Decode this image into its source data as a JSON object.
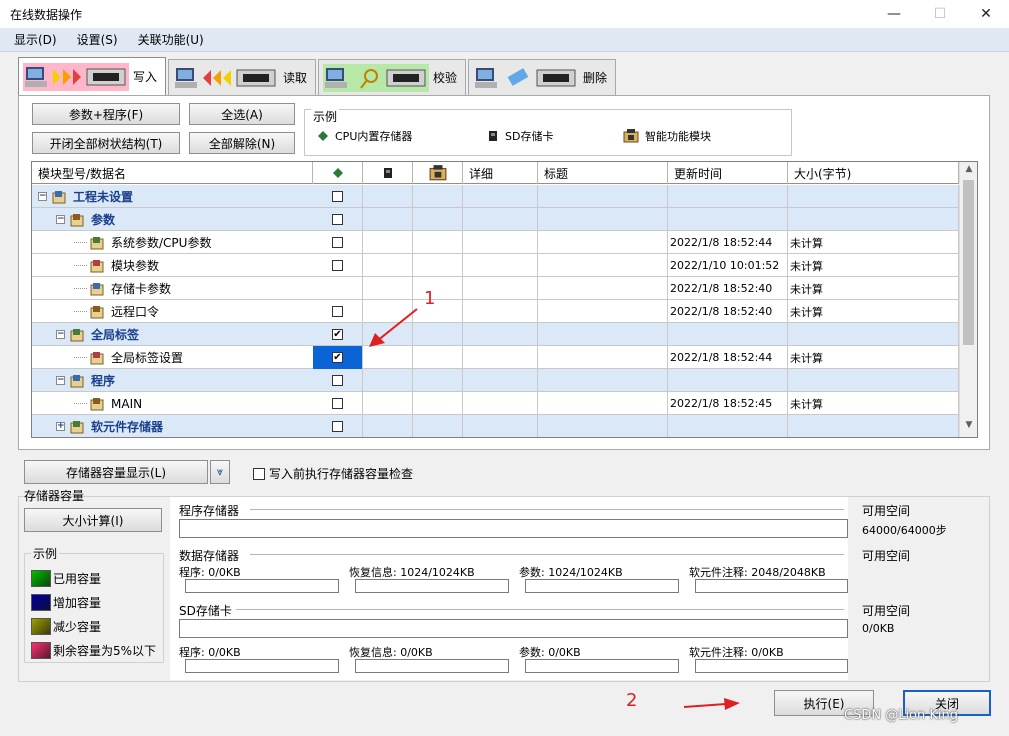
{
  "window": {
    "title": "在线数据操作",
    "minimize": "—",
    "maximize": "☐",
    "close": "✕"
  },
  "menu": [
    "显示(D)",
    "设置(S)",
    "关联功能(U)"
  ],
  "tabs": [
    {
      "label": "写入",
      "active": true
    },
    {
      "label": "读取",
      "active": false
    },
    {
      "label": "校验",
      "active": false
    },
    {
      "label": "删除",
      "active": false
    }
  ],
  "buttons": {
    "param_program": "参数+程序(F)",
    "select_all": "全选(A)",
    "toggle_tree": "开闭全部树状结构(T)",
    "deselect_all": "全部解除(N)",
    "mem_capacity": "存储器容量显示(L)",
    "size_calc": "大小计算(I)",
    "execute": "执行(E)",
    "close": "关闭"
  },
  "legend_top": {
    "title": "示例",
    "items": [
      "CPU内置存储器",
      "SD存储卡",
      "智能功能模块"
    ]
  },
  "grid": {
    "headers": [
      "模块型号/数据名",
      "",
      "",
      "",
      "详细",
      "标题",
      "更新时间",
      "大小(字节)"
    ],
    "rows": [
      {
        "name": "工程未设置",
        "level": 0,
        "group": true,
        "expander": "−",
        "cpu": "unchecked",
        "time": "",
        "size": ""
      },
      {
        "name": "参数",
        "level": 1,
        "group": true,
        "expander": "−",
        "cpu": "unchecked",
        "time": "",
        "size": ""
      },
      {
        "name": "系统参数/CPU参数",
        "level": 2,
        "group": false,
        "expander": "",
        "cpu": "unchecked",
        "time": "2022/1/8 18:52:44",
        "size": "未计算"
      },
      {
        "name": "模块参数",
        "level": 2,
        "group": false,
        "expander": "",
        "cpu": "unchecked",
        "time": "2022/1/10 10:01:52",
        "size": "未计算"
      },
      {
        "name": "存储卡参数",
        "level": 2,
        "group": false,
        "expander": "",
        "cpu": "none",
        "time": "2022/1/8 18:52:40",
        "size": "未计算"
      },
      {
        "name": "远程口令",
        "level": 2,
        "group": false,
        "expander": "",
        "cpu": "unchecked",
        "time": "2022/1/8 18:52:40",
        "size": "未计算"
      },
      {
        "name": "全局标签",
        "level": 1,
        "group": true,
        "expander": "−",
        "cpu": "checked",
        "time": "",
        "size": ""
      },
      {
        "name": "全局标签设置",
        "level": 2,
        "group": false,
        "expander": "",
        "cpu": "checked-selected",
        "time": "2022/1/8 18:52:44",
        "size": "未计算"
      },
      {
        "name": "程序",
        "level": 1,
        "group": true,
        "expander": "−",
        "cpu": "unchecked",
        "time": "",
        "size": ""
      },
      {
        "name": "MAIN",
        "level": 2,
        "group": false,
        "expander": "",
        "cpu": "unchecked",
        "time": "2022/1/8 18:52:45",
        "size": "未计算"
      },
      {
        "name": "软元件存储器",
        "level": 1,
        "group": true,
        "expander": "+",
        "cpu": "unchecked",
        "time": "",
        "size": ""
      }
    ]
  },
  "check_before_write": "写入前执行存储器容量检查",
  "capacity": {
    "title": "存储器容量",
    "program_memory": "程序存储器",
    "data_memory": "数据存储器",
    "sd_card": "SD存储卡",
    "available": "可用空间",
    "program_avail": "64000/64000步",
    "sd_avail": "0/0KB",
    "data_items": [
      "程序: 0/0KB",
      "恢复信息: 1024/1024KB",
      "参数: 1024/1024KB",
      "软元件注释: 2048/2048KB"
    ],
    "sd_items": [
      "程序: 0/0KB",
      "恢复信息: 0/0KB",
      "参数: 0/0KB",
      "软元件注释: 0/0KB"
    ]
  },
  "legend_bottom": {
    "title": "示例",
    "items": [
      {
        "label": "已用容量",
        "color": "#00c000"
      },
      {
        "label": "增加容量",
        "color": "#0000a0"
      },
      {
        "label": "减少容量",
        "color": "#a0a000"
      },
      {
        "label": "剩余容量为5%以下",
        "color": "#ff3070"
      }
    ]
  },
  "annotations": [
    "1",
    "2"
  ],
  "watermark": "CSDN @Lion King"
}
